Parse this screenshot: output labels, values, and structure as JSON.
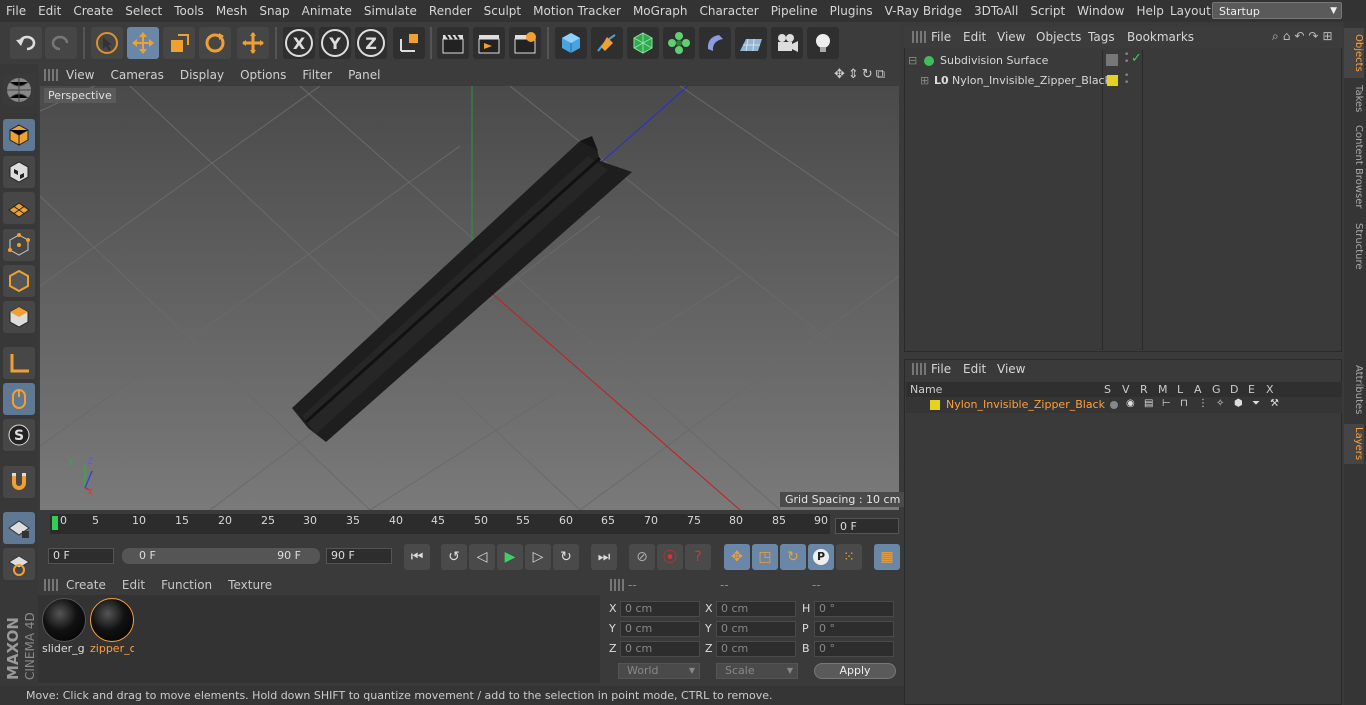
{
  "menubar": {
    "items": [
      "File",
      "Edit",
      "Create",
      "Select",
      "Tools",
      "Mesh",
      "Snap",
      "Animate",
      "Simulate",
      "Render",
      "Sculpt",
      "Motion Tracker",
      "MoGraph",
      "Character",
      "Pipeline",
      "Plugins",
      "V-Ray Bridge",
      "3DToAll",
      "Script",
      "Window",
      "Help"
    ],
    "layout_label": "Layout:",
    "layout_value": "Startup"
  },
  "toolbar": {
    "x_label": "X",
    "y_label": "Y",
    "z_label": "Z"
  },
  "viewport": {
    "menu": [
      "View",
      "Cameras",
      "Display",
      "Options",
      "Filter",
      "Panel"
    ],
    "label": "Perspective",
    "grid_spacing": "Grid Spacing : 10 cm"
  },
  "timeline": {
    "ticks": [
      "0",
      "5",
      "10",
      "15",
      "20",
      "25",
      "30",
      "35",
      "40",
      "45",
      "50",
      "55",
      "60",
      "65",
      "70",
      "75",
      "80",
      "85",
      "90"
    ],
    "current_frame": "0 F",
    "start_frame": "0 F",
    "range_start": "0 F",
    "range_end": "90 F",
    "end_frame": "90 F"
  },
  "materials": {
    "menu": [
      "Create",
      "Edit",
      "Function",
      "Texture"
    ],
    "items": [
      {
        "name": "slider_g",
        "selected": false
      },
      {
        "name": "zipper_c",
        "selected": true
      }
    ]
  },
  "coordinates": {
    "headers": [
      "--",
      "--",
      "--"
    ],
    "rows": [
      {
        "l1": "X",
        "v1": "0 cm",
        "l2": "X",
        "v2": "0 cm",
        "l3": "H",
        "v3": "0 °"
      },
      {
        "l1": "Y",
        "v1": "0 cm",
        "l2": "Y",
        "v2": "0 cm",
        "l3": "P",
        "v3": "0 °"
      },
      {
        "l1": "Z",
        "v1": "0 cm",
        "l2": "Z",
        "v2": "0 cm",
        "l3": "B",
        "v3": "0 °"
      }
    ],
    "mode": "World",
    "scale": "Scale",
    "apply": "Apply"
  },
  "status": "Move: Click and drag to move elements. Hold down SHIFT to quantize movement / add to the selection in point mode, CTRL to remove.",
  "objects": {
    "menu": [
      "File",
      "Edit",
      "View",
      "Objects",
      "Tags",
      "Bookmarks"
    ],
    "tree": [
      {
        "name": "Subdivision Surface"
      },
      {
        "name": "Nylon_Invisible_Zipper_Black"
      }
    ]
  },
  "layers": {
    "menu": [
      "File",
      "Edit",
      "View"
    ],
    "columns": [
      "Name",
      "S",
      "V",
      "R",
      "M",
      "L",
      "A",
      "G",
      "D",
      "E",
      "X"
    ],
    "rows": [
      {
        "name": "Nylon_Invisible_Zipper_Black"
      }
    ]
  },
  "right_tabs": [
    "Objects",
    "Takes",
    "Content Browser",
    "Structure",
    "Attributes",
    "Layers"
  ],
  "colors": {
    "accent": "#ffa03a",
    "selected_blue": "#6b87a8",
    "layer_yellow": "#e6d21e"
  }
}
